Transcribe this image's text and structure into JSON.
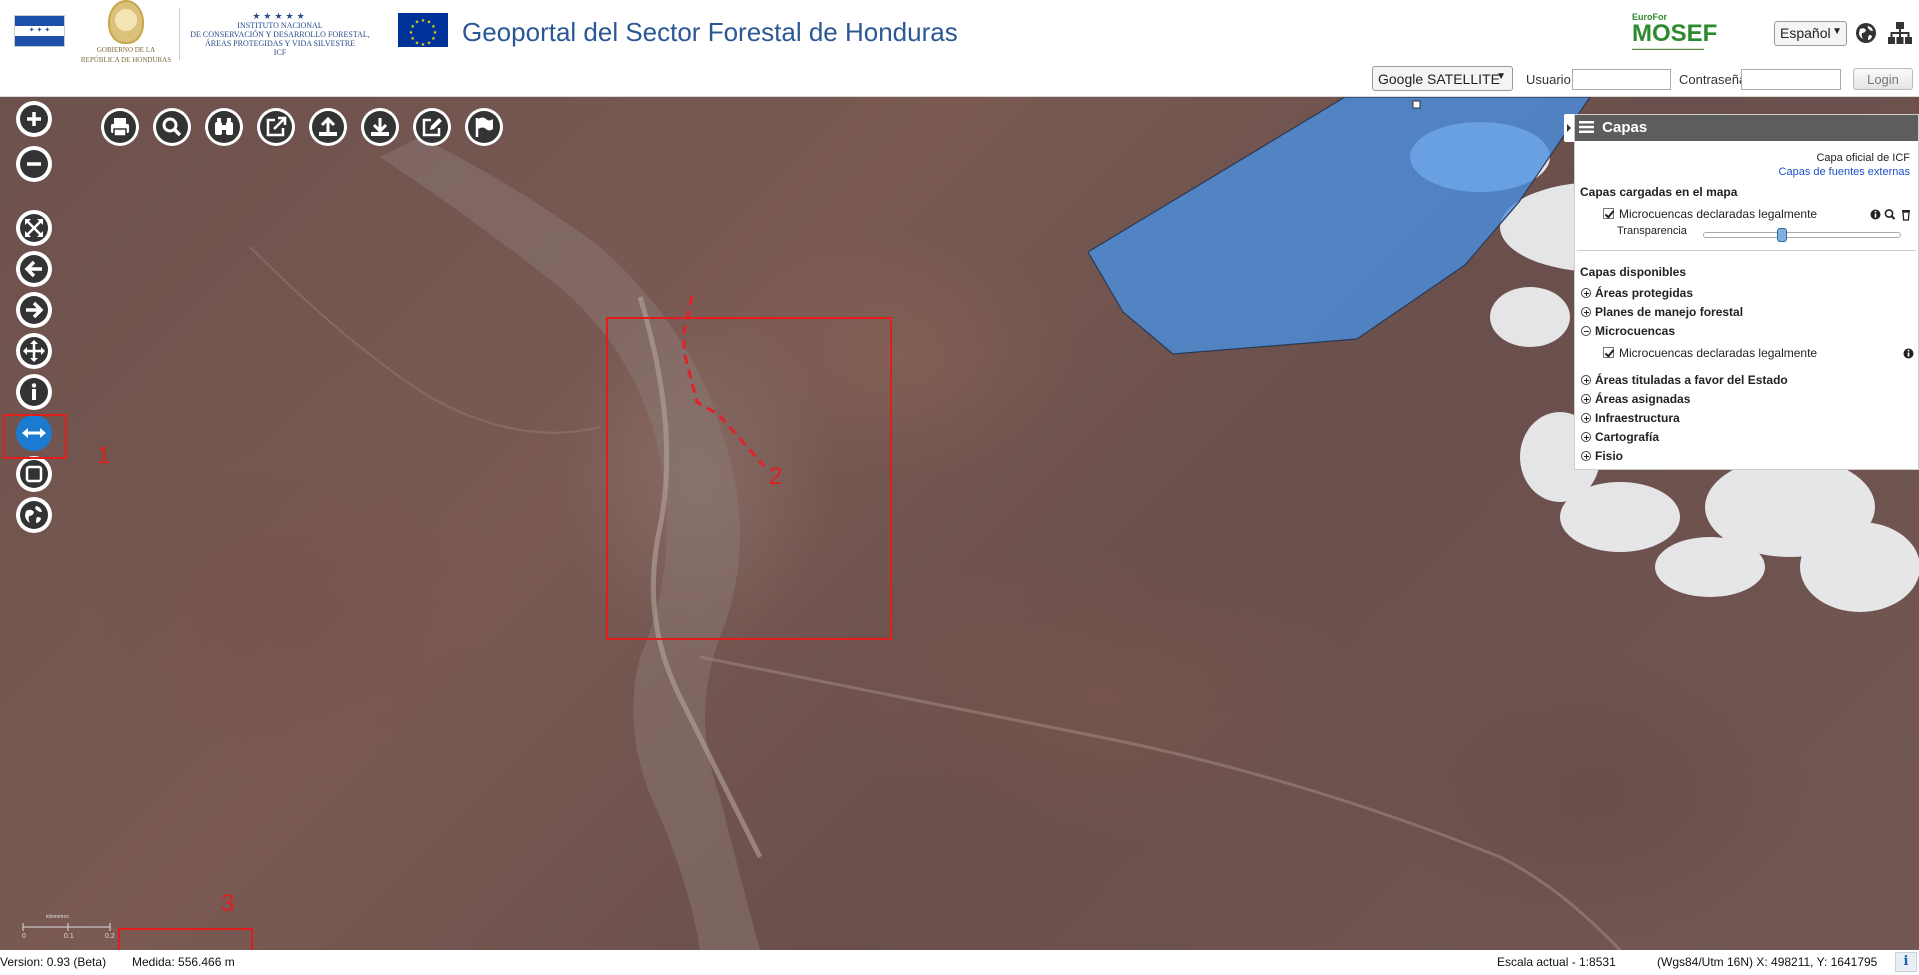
{
  "header": {
    "title": "Geoportal del Sector Forestal de Honduras",
    "gov_logo_text": [
      "Gobierno de la",
      "República de Honduras"
    ],
    "icf_logo_text": [
      "Instituto Nacional",
      "de Conservación y Desarrollo Forestal,",
      "Áreas Protegidas y Vida Silvestre",
      "ICF"
    ],
    "mosef_logo": {
      "top": "EuroFor",
      "main": "MOSEF"
    },
    "language": "Español",
    "basemap": "Google SATELLITE",
    "user_label": "Usuario",
    "user_value": "",
    "password_label": "Contraseña",
    "password_value": "",
    "login_label": "Login"
  },
  "left_tools": [
    {
      "name": "zoom-in",
      "icon": "plus-circle-icon"
    },
    {
      "name": "zoom-out",
      "icon": "minus-circle-icon"
    },
    {
      "name": "full-extent",
      "icon": "expand-arrows-icon"
    },
    {
      "name": "previous-extent",
      "icon": "arrow-left-icon"
    },
    {
      "name": "next-extent",
      "icon": "arrow-right-icon"
    },
    {
      "name": "pan",
      "icon": "move-icon"
    },
    {
      "name": "identify",
      "icon": "info-icon"
    },
    {
      "name": "measure-distance",
      "icon": "horizontal-arrows-icon",
      "active": true
    },
    {
      "name": "measure-area",
      "icon": "square-icon"
    },
    {
      "name": "globe",
      "icon": "globe-icon"
    }
  ],
  "top_tools": [
    {
      "name": "print",
      "icon": "printer-icon"
    },
    {
      "name": "search",
      "icon": "magnifier-icon"
    },
    {
      "name": "find",
      "icon": "binoculars-icon"
    },
    {
      "name": "external-link",
      "icon": "external-link-icon"
    },
    {
      "name": "upload",
      "icon": "upload-icon"
    },
    {
      "name": "download",
      "icon": "download-icon"
    },
    {
      "name": "edit",
      "icon": "edit-icon"
    },
    {
      "name": "flag",
      "icon": "flag-icon"
    }
  ],
  "annotations": [
    "1",
    "2",
    "3"
  ],
  "layers_panel": {
    "title": "Capas",
    "official_label": "Capa oficial de ICF",
    "external_link": "Capas de fuentes externas",
    "loaded_heading": "Capas cargadas en el mapa",
    "loaded_layer": "Microcuencas declaradas legalmente",
    "transparency_label": "Transparencia",
    "transparency_value": 0.4,
    "available_heading": "Capas disponibles",
    "categories": [
      "Áreas protegidas",
      "Planes de manejo forestal",
      "Microcuencas",
      "Áreas tituladas a favor del Estado",
      "Áreas asignadas",
      "Infraestructura",
      "Cartografía",
      "Fisio"
    ],
    "expanded_sublayer": "Microcuencas declaradas legalmente"
  },
  "scale_bar": {
    "labels": [
      "0",
      "0.1",
      "0.2"
    ],
    "unit": "kilometros"
  },
  "status": {
    "version": "Version: 0.93 (Beta)",
    "measure": "Medida: 556.466 m",
    "scale": "Escala actual - 1:8531",
    "coords": "(Wgs84/Utm 16N) X: 498211, Y: 1641795"
  },
  "colors": {
    "accent": "#1a7bd0",
    "title": "#2b5895",
    "annotation": "#e51c1c",
    "polygon_fill": "#4a8fe0"
  }
}
